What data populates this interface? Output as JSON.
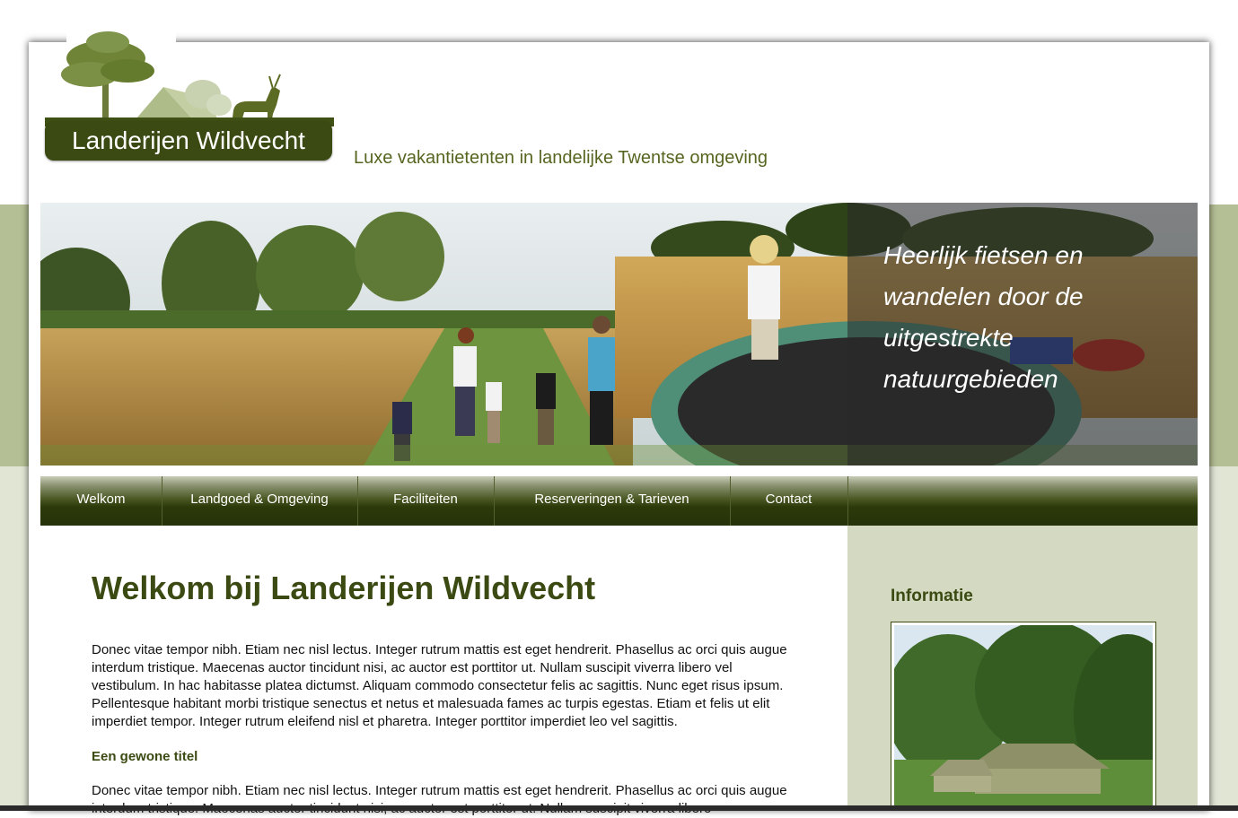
{
  "site": {
    "logo_text": "Landerijen Wildvecht",
    "tagline": "Luxe vakantietenten in landelijke Twentse omgeving"
  },
  "banner": {
    "caption": "Heerlijk fietsen en wandelen door de uitgestrekte natuurgebieden"
  },
  "nav": {
    "items": [
      {
        "label": "Welkom"
      },
      {
        "label": "Landgoed & Omgeving"
      },
      {
        "label": "Faciliteiten"
      },
      {
        "label": "Reserveringen & Tarieven"
      },
      {
        "label": "Contact"
      }
    ]
  },
  "main": {
    "title": "Welkom bij Landerijen Wildvecht",
    "paragraph1": "Donec vitae tempor nibh. Etiam nec nisl lectus. Integer rutrum mattis est eget hendrerit. Phasellus ac orci quis augue interdum tristique. Maecenas auctor tincidunt nisi, ac auctor est porttitor ut. Nullam suscipit viverra libero vel vestibulum. In hac habitasse platea dictumst. Aliquam commodo consectetur felis ac sagittis. Nunc eget risus ipsum. Pellentesque habitant morbi tristique senectus et netus et malesuada fames ac turpis egestas. Etiam et felis ut elit imperdiet tempor. Integer rutrum eleifend nisl et pharetra. Integer porttitor imperdiet leo vel sagittis.",
    "subtitle": "Een gewone titel",
    "paragraph2": "Donec vitae tempor nibh. Etiam nec nisl lectus. Integer rutrum mattis est eget hendrerit. Phasellus ac orci quis augue interdum tristique. Maecenas auctor tincidunt nisi, ac auctor est porttitor ut. Nullam suscipit viverra libero"
  },
  "sidebar": {
    "title": "Informatie"
  },
  "colors": {
    "brand_dark": "#3b4a12",
    "band_green": "#b4bf95",
    "light_green": "#e0e5d4",
    "sidebar_bg": "#d4dac1"
  }
}
